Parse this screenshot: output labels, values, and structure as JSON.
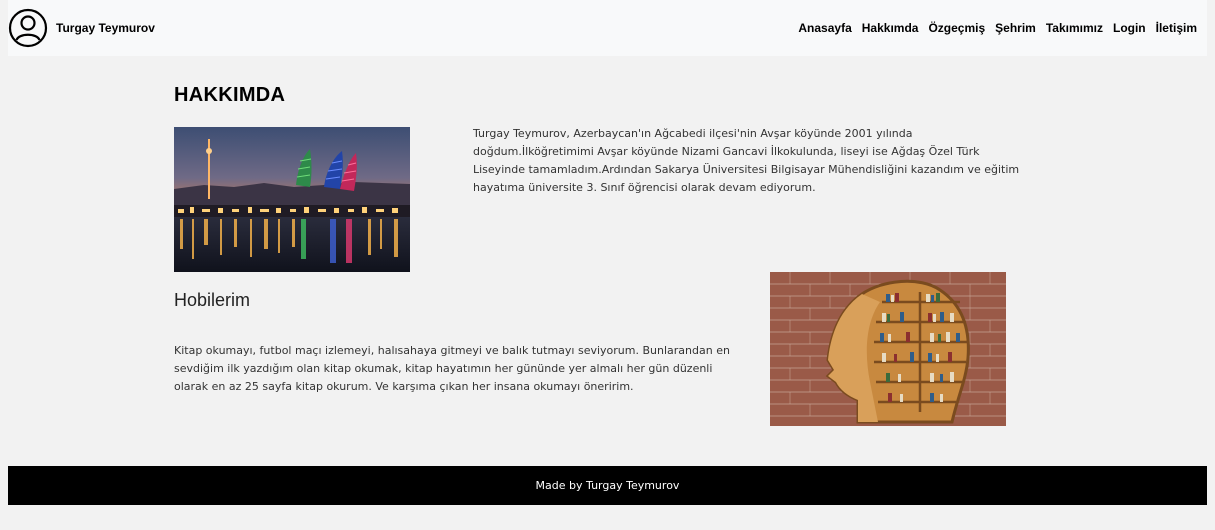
{
  "navbar": {
    "brand_name": "Turgay Teymurov",
    "links": [
      {
        "label": "Anasayfa"
      },
      {
        "label": "Hakkımda"
      },
      {
        "label": "Özgeçmiş"
      },
      {
        "label": "Şehrim"
      },
      {
        "label": "Takımımız"
      },
      {
        "label": "Login"
      },
      {
        "label": "İletişim"
      }
    ]
  },
  "about": {
    "title": "HAKKIMDA",
    "text": "Turgay Teymurov, Azerbaycan'ın Ağcabedi ilçesi'nin Avşar köyünde 2001 yılında doğdum.İlköğretimimi Avşar köyünde Nizami Gancavi İlkokulunda, liseyi ise Ağdaş Özel Türk Liseyinde tamamladım.Ardından Sakarya Üniversitesi Bilgisayar Mühendisliğini kazandım ve eğitim hayatıma üniversite 3. Sınıf öğrencisi olarak devam ediyorum."
  },
  "hobbies": {
    "title": "Hobilerim",
    "text": "Kitap okumayı, futbol maçı izlemeyi, halısahaya gitmeyi ve balık tutmayı seviyorum. Bunlarandan en sevdiğim ilk yazdığım olan kitap okumak, kitap hayatımın her gününde yer almalı her gün düzenli olarak en az 25 sayfa kitap okurum. Ve karşıma çıkan her insana okumayı öneririm."
  },
  "footer": {
    "text": "Made by Turgay Teymurov"
  }
}
